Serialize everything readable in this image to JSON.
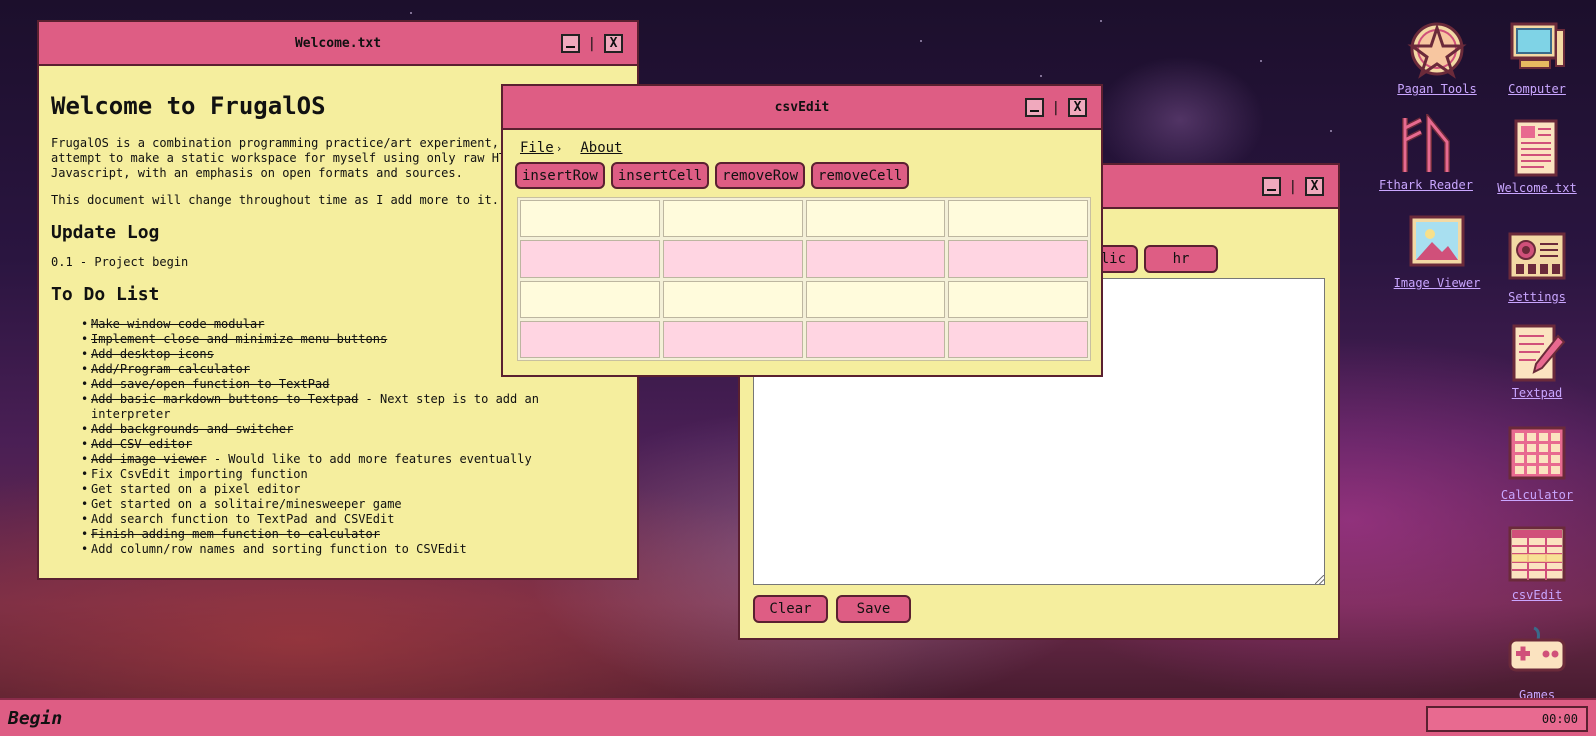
{
  "welcome_window": {
    "title": "Welcome.txt",
    "heading": "Welcome to FrugalOS",
    "intro_line1": "FrugalOS is a combination programming practice/art experiment, an",
    "intro_line2": "attempt to make a static workspace for myself using only raw HTML/CSS/",
    "intro_line3": "Javascript, with an emphasis on open formats and sources.",
    "notice": "This document will change throughout time as I add more to it.",
    "update_heading": "Update Log",
    "update_entry": "0.1 - Project begin",
    "todo_heading": "To Do List",
    "todo": [
      {
        "text": "Make window code modular",
        "done": true,
        "note": ""
      },
      {
        "text": "Implement close and minimize menu buttons",
        "done": true,
        "note": ""
      },
      {
        "text": "Add desktop icons",
        "done": true,
        "note": ""
      },
      {
        "text": "Add/Program calculator",
        "done": true,
        "note": ""
      },
      {
        "text": "Add save/open function to TextPad",
        "done": true,
        "note": ""
      },
      {
        "text": "Add basic markdown buttons to Textpad",
        "done": true,
        "note": " - Next step is to add an interpreter"
      },
      {
        "text": "Add backgrounds and switcher",
        "done": true,
        "note": ""
      },
      {
        "text": "Add CSV editor",
        "done": true,
        "note": ""
      },
      {
        "text": "Add image viewer",
        "done": true,
        "note": " - Would like to add more features eventually"
      },
      {
        "text": "Fix CsvEdit importing function",
        "done": false,
        "note": ""
      },
      {
        "text": "Get started on a pixel editor",
        "done": false,
        "note": ""
      },
      {
        "text": "Get started on a solitaire/minesweeper game",
        "done": false,
        "note": ""
      },
      {
        "text": "Add search function to TextPad and CSVEdit",
        "done": false,
        "note": ""
      },
      {
        "text": "Finish adding mem function to calculator",
        "done": true,
        "note": ""
      },
      {
        "text": "Add column/row names and sorting function to CSVEdit",
        "done": false,
        "note": ""
      }
    ]
  },
  "window_controls": {
    "minimize_glyph": "_",
    "separator": "|",
    "close_glyph": "X"
  },
  "csv_window": {
    "title": "csvEdit",
    "menu": {
      "file": "File",
      "file_chevron": "›",
      "about": "About"
    },
    "buttons": {
      "insert_row": "insertRow",
      "insert_cell": "insertCell",
      "remove_row": "removeRow",
      "remove_cell": "removeCell"
    },
    "grid": {
      "rows": 4,
      "cols": 4
    }
  },
  "textpad_window": {
    "format_buttons": {
      "italic": "italic",
      "hr": "hr"
    },
    "textarea_value": "",
    "clear_label": "Clear",
    "save_label": "Save"
  },
  "desktop_icons": [
    {
      "label": "Pagan Tools",
      "icon": "pentagram-icon"
    },
    {
      "label": "Computer",
      "icon": "computer-icon"
    },
    {
      "label": "Fthark Reader",
      "icon": "runes-icon"
    },
    {
      "label": "Welcome.txt",
      "icon": "text-document-icon"
    },
    {
      "label": "Image Viewer",
      "icon": "picture-icon"
    },
    {
      "label": "Settings",
      "icon": "settings-panel-icon"
    },
    {
      "label": "Textpad",
      "icon": "notepad-pencil-icon"
    },
    {
      "label": "Calculator",
      "icon": "calculator-icon"
    },
    {
      "label": "csvEdit",
      "icon": "spreadsheet-icon"
    },
    {
      "label": "Games",
      "icon": "gamepad-icon"
    }
  ],
  "taskbar": {
    "begin_label": "Begin",
    "clock": "00:00"
  },
  "colors": {
    "titlebar": "#de5d84",
    "window_bg": "#f5ee9e",
    "icon_label": "#c9a6ff"
  }
}
